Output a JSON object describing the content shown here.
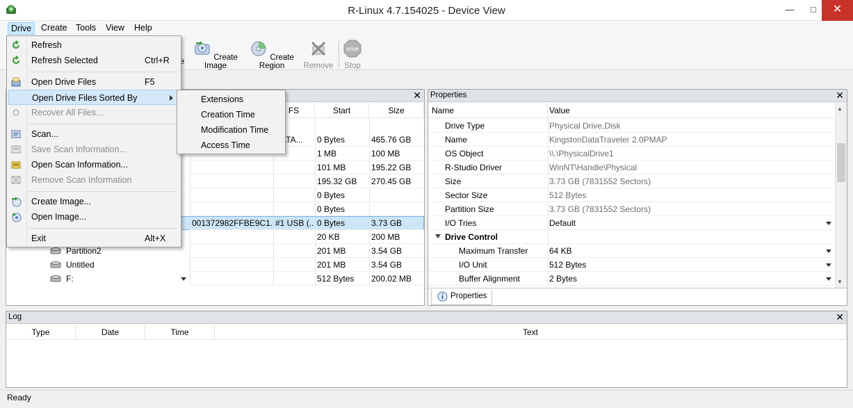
{
  "window": {
    "title": "R-Linux 4.7.154025 - Device View",
    "minimize": "—",
    "maximize": "□",
    "close": "✕"
  },
  "menubar": {
    "items": [
      "Drive",
      "Create",
      "Tools",
      "View",
      "Help"
    ]
  },
  "toolbar": {
    "buttons": [
      {
        "label": "Create Image",
        "icon": "create-image-icon",
        "enabled": true
      },
      {
        "label": "Create Region",
        "icon": "create-region-icon",
        "enabled": true
      },
      {
        "label": "Remove",
        "icon": "remove-icon",
        "enabled": false
      },
      {
        "label": "Stop",
        "icon": "stop-icon",
        "enabled": false
      }
    ],
    "hidden_label_tail": "e",
    "stop_badge": "STOP"
  },
  "drive_menu": {
    "items": [
      {
        "label": "Refresh",
        "shortcut": "",
        "enabled": true
      },
      {
        "label": "Refresh Selected",
        "shortcut": "Ctrl+R",
        "enabled": true
      },
      {
        "label": "Open Drive Files",
        "shortcut": "F5",
        "enabled": true
      },
      {
        "label": "Open Drive Files Sorted By",
        "shortcut": "",
        "enabled": true
      },
      {
        "label": "Recover All Files...",
        "shortcut": "",
        "enabled": false
      },
      {
        "label": "Scan...",
        "shortcut": "",
        "enabled": true
      },
      {
        "label": "Save Scan Information...",
        "shortcut": "",
        "enabled": false
      },
      {
        "label": "Open Scan Information...",
        "shortcut": "",
        "enabled": true
      },
      {
        "label": "Remove Scan Information",
        "shortcut": "",
        "enabled": false
      },
      {
        "label": "Create Image...",
        "shortcut": "",
        "enabled": true
      },
      {
        "label": "Open Image...",
        "shortcut": "",
        "enabled": true
      },
      {
        "label": "Exit",
        "shortcut": "Alt+X",
        "enabled": true
      }
    ]
  },
  "sorted_by_submenu": {
    "items": [
      "Extensions",
      "Creation Time",
      "Modification Time",
      "Access Time"
    ]
  },
  "drives_panel": {
    "close": "✕",
    "columns": {
      "fs": "FS",
      "start": "Start",
      "size": "Size"
    },
    "rows": [
      {
        "name": "",
        "id": "",
        "fs": "SATA...",
        "start": "0 Bytes",
        "size": "465.76 GB"
      },
      {
        "name": "",
        "id": "",
        "fs": "",
        "start": "1 MB",
        "size": "100 MB"
      },
      {
        "name": "",
        "id": "",
        "fs": "",
        "start": "101 MB",
        "size": "195.22 GB"
      },
      {
        "name": "",
        "id": "",
        "fs": "",
        "start": "195.32 GB",
        "size": "270.45 GB"
      },
      {
        "name": "",
        "id": "",
        "fs": "",
        "start": "0 Bytes",
        "size": ""
      },
      {
        "name": "",
        "id": "",
        "fs": "",
        "start": "0 Bytes",
        "size": ""
      },
      {
        "name": "",
        "id": "001372982FFBE9C1...",
        "fs": "#1 USB (...",
        "start": "0 Bytes",
        "size": "3.73 GB"
      },
      {
        "name": "",
        "id": "",
        "fs": "",
        "start": "20 KB",
        "size": "200 MB"
      },
      {
        "name": "Partition2",
        "id": "",
        "fs": "",
        "start": "201 MB",
        "size": "3.54 GB"
      },
      {
        "name": "Untitled",
        "id": "",
        "fs": "",
        "start": "201 MB",
        "size": "3.54 GB"
      },
      {
        "name": "F:",
        "id": "",
        "fs": "",
        "start": "512 Bytes",
        "size": "200.02 MB"
      }
    ]
  },
  "properties_panel": {
    "title": "Properties",
    "close": "✕",
    "columns": {
      "name": "Name",
      "value": "Value"
    },
    "rows": [
      {
        "name": "Drive Type",
        "value": "Physical Drive,Disk",
        "dropdown": false,
        "dark": false,
        "group": false
      },
      {
        "name": "Name",
        "value": "KingstonDataTraveler 2.0PMAP",
        "dropdown": false,
        "dark": false,
        "group": false
      },
      {
        "name": "OS Object",
        "value": "\\\\.\\PhysicalDrive1",
        "dropdown": false,
        "dark": false,
        "group": false
      },
      {
        "name": "R-Studio Driver",
        "value": "WinNT\\Handle\\Physical",
        "dropdown": false,
        "dark": false,
        "group": false
      },
      {
        "name": "Size",
        "value": "3.73 GB (7831552 Sectors)",
        "dropdown": false,
        "dark": false,
        "group": false
      },
      {
        "name": "Sector Size",
        "value": "512 Bytes",
        "dropdown": false,
        "dark": false,
        "group": false
      },
      {
        "name": "Partition Size",
        "value": "3.73 GB (7831552 Sectors)",
        "dropdown": false,
        "dark": false,
        "group": false
      },
      {
        "name": "I/O Tries",
        "value": "Default",
        "dropdown": true,
        "dark": true,
        "group": false
      },
      {
        "name": "Drive Control",
        "value": "",
        "dropdown": false,
        "dark": true,
        "group": true
      },
      {
        "name": "Maximum Transfer",
        "value": "64 KB",
        "dropdown": true,
        "dark": true,
        "group": false
      },
      {
        "name": "I/O Unit",
        "value": "512 Bytes",
        "dropdown": true,
        "dark": true,
        "group": false
      },
      {
        "name": "Buffer Alignment",
        "value": "2 Bytes",
        "dropdown": true,
        "dark": true,
        "group": false
      }
    ],
    "tab_label": "Properties"
  },
  "log_panel": {
    "title": "Log",
    "close": "✕",
    "columns": {
      "type": "Type",
      "date": "Date",
      "time": "Time",
      "text": "Text"
    }
  },
  "status": {
    "text": "Ready"
  }
}
